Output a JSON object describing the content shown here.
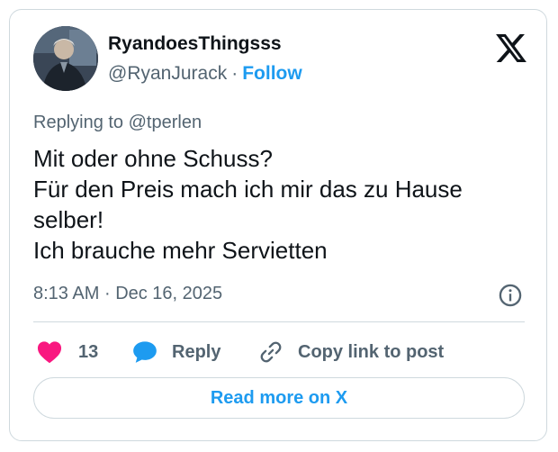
{
  "author": {
    "display_name": "RyandoesThingsss",
    "handle": "@RyanJurack",
    "separator": "·",
    "follow_label": "Follow"
  },
  "reply": {
    "prefix": "Replying to",
    "mention": "@tperlen"
  },
  "tweet": {
    "lines": [
      "Mit oder ohne Schuss?",
      "Für den Preis mach ich mir das zu Hause",
      "selber!",
      "Ich brauche mehr Servietten"
    ]
  },
  "meta": {
    "time": "8:13 AM",
    "separator": "·",
    "date": "Dec 16, 2025"
  },
  "actions": {
    "like_count": "13",
    "reply_label": "Reply",
    "copy_label": "Copy link to post"
  },
  "footer": {
    "read_more_label": "Read more on X"
  },
  "icons": {
    "brand": "x-logo-icon",
    "avatar": "avatar",
    "info": "info-icon",
    "like": "heart-icon",
    "reply": "speech-bubble-icon",
    "copy": "link-icon"
  },
  "colors": {
    "accent": "#1d9bf0",
    "like": "#f91880",
    "text_primary": "#0f1419",
    "text_secondary": "#536471",
    "border": "#cfd9de"
  }
}
